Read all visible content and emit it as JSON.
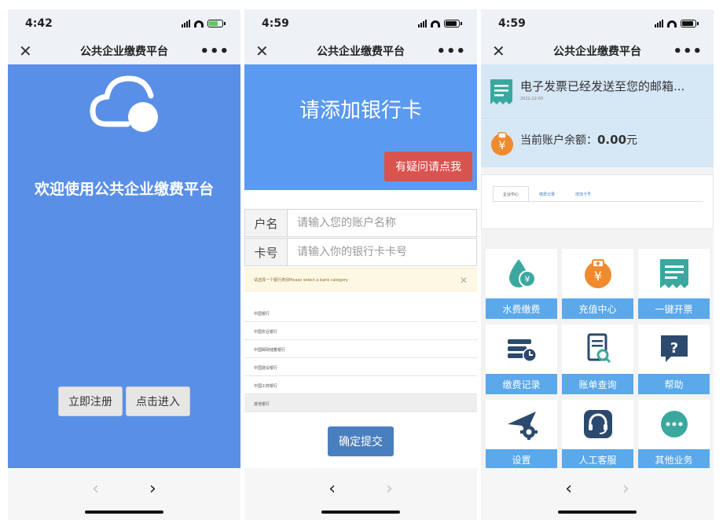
{
  "colors": {
    "primary_blue": "#5a8fe8",
    "header_blue": "#5a9af0",
    "danger": "#d9534f",
    "submit": "#4a7fbf",
    "tile_label": "#5ba8ea",
    "teal_icon": "#3aa89f",
    "orange_icon": "#ef8a2e",
    "navy_icon": "#2c4a6e"
  },
  "navbar": {
    "title": "公共企业缴费平台",
    "close_icon": "close-icon",
    "more_icon": "more-icon"
  },
  "bottom": {
    "back_icon": "chevron-left-icon",
    "forward_icon": "chevron-right-icon"
  },
  "phone1": {
    "status_time": "4:42",
    "welcome": "欢迎使用公共企业缴费平台",
    "icon": "cloud-icon",
    "buttons": {
      "register": "立即注册",
      "enter": "点击进入"
    }
  },
  "phone2": {
    "status_time": "4:59",
    "title": "请添加银行卡",
    "help_button": "有疑问请点我",
    "form": {
      "name_label": "户名",
      "name_placeholder": "请输入您的账户名称",
      "card_label": "卡号",
      "card_placeholder": "请输入你的银行卡卡号"
    },
    "alert": "请选择一个银行类别Please select a bank category",
    "banks": [
      "中国银行",
      "中国农业银行",
      "中国邮政储蓄银行",
      "中国建设银行",
      "中国工商银行",
      "其他银行"
    ],
    "submit": "确定提交"
  },
  "phone3": {
    "status_time": "4:59",
    "notice": {
      "text": "电子发票已经发送至您的邮箱...",
      "date": "2021-12-03",
      "icon": "invoice-icon"
    },
    "balance": {
      "label": "当前账户余额：",
      "amount": "0.00",
      "unit": "元",
      "icon": "yuan-coin-icon"
    },
    "tabs": [
      "企业中心",
      "缴费记录",
      "增加卡号"
    ],
    "tiles": [
      {
        "label": "水费缴费",
        "icon": "water-drop-icon"
      },
      {
        "label": "充值中心",
        "icon": "recharge-icon"
      },
      {
        "label": "一键开票",
        "icon": "invoice-icon"
      },
      {
        "label": "缴费记录",
        "icon": "payment-record-icon"
      },
      {
        "label": "账单查询",
        "icon": "bill-search-icon"
      },
      {
        "label": "帮助",
        "icon": "help-icon"
      },
      {
        "label": "设置",
        "icon": "settings-icon"
      },
      {
        "label": "人工客服",
        "icon": "customer-service-icon"
      },
      {
        "label": "其他业务",
        "icon": "more-business-icon"
      }
    ]
  }
}
